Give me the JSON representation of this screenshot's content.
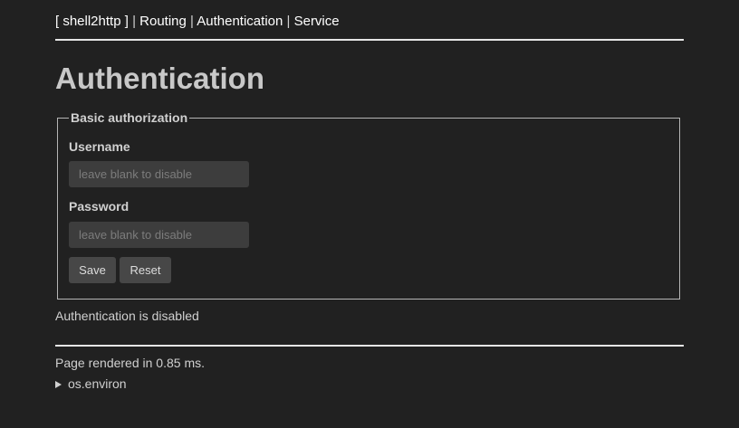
{
  "nav": {
    "brand": "[ shell2http ]",
    "separator": "|",
    "links": [
      "Routing",
      "Authentication",
      "Service"
    ]
  },
  "page_title": "Authentication",
  "form": {
    "legend": "Basic authorization",
    "username_label": "Username",
    "username_value": "",
    "username_placeholder": "leave blank to disable",
    "password_label": "Password",
    "password_value": "",
    "password_placeholder": "leave blank to disable",
    "save_label": "Save",
    "reset_label": "Reset"
  },
  "status": "Authentication is disabled",
  "footer": {
    "rendered": "Page rendered in 0.85 ms.",
    "details_label": "os.environ"
  },
  "colors": {
    "background": "#212121",
    "text": "#d0d0d0",
    "link": "#ffffff",
    "input_bg": "#3d3d3d",
    "button_bg": "#474747"
  }
}
